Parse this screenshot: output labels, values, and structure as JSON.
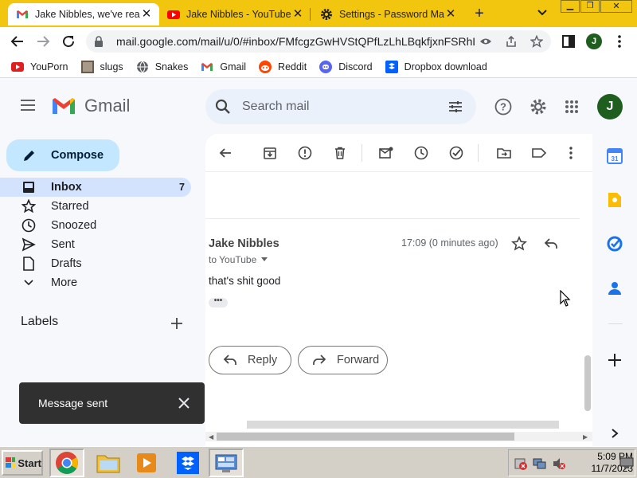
{
  "browser": {
    "tabs": [
      {
        "title": "Jake Nibbles, we've reac",
        "favicon": "gmail-icon",
        "active": true
      },
      {
        "title": "Jake Nibbles - YouTube",
        "favicon": "youtube-icon",
        "active": false
      },
      {
        "title": "Settings - Password Ma",
        "favicon": "gear-icon",
        "active": false
      }
    ],
    "url": "mail.google.com/mail/u/0/#inbox/FMfcgzGwHVStQPfLzLhLBqkfjxnFSRhL",
    "profile_initial": "J",
    "bookmarks": [
      {
        "label": "YouPorn",
        "icon": "youporn-icon"
      },
      {
        "label": "slugs",
        "icon": "image-icon"
      },
      {
        "label": "Snakes",
        "icon": "globe-icon"
      },
      {
        "label": "Gmail",
        "icon": "gmail-icon"
      },
      {
        "label": "Reddit",
        "icon": "reddit-icon"
      },
      {
        "label": "Discord",
        "icon": "discord-icon"
      },
      {
        "label": "Dropbox download",
        "icon": "dropbox-icon"
      }
    ]
  },
  "gmail": {
    "brand": "Gmail",
    "search_placeholder": "Search mail",
    "avatar_initial": "J",
    "compose_label": "Compose",
    "nav": [
      {
        "label": "Inbox",
        "count": "7",
        "icon": "inbox-icon",
        "active": true
      },
      {
        "label": "Starred",
        "count": "",
        "icon": "star-icon",
        "active": false
      },
      {
        "label": "Snoozed",
        "count": "",
        "icon": "clock-icon",
        "active": false
      },
      {
        "label": "Sent",
        "count": "",
        "icon": "send-icon",
        "active": false
      },
      {
        "label": "Drafts",
        "count": "",
        "icon": "draft-icon",
        "active": false
      },
      {
        "label": "More",
        "count": "",
        "icon": "chevron-down-icon",
        "active": false
      }
    ],
    "labels_heading": "Labels",
    "message": {
      "sender": "Jake Nibbles",
      "time": "17:09 (0 minutes ago)",
      "to": "to YouTube",
      "body": "that's shit good",
      "dots": "•••"
    },
    "reply_label": "Reply",
    "forward_label": "Forward",
    "snackbar": "Message sent"
  },
  "taskbar": {
    "start_label": "Start",
    "time": "5:09 PM",
    "date": "11/7/2023"
  },
  "colors": {
    "tab_strip": "#f2c60e",
    "compose_bg": "#c2e7ff",
    "nav_active_bg": "#d3e3fd",
    "avatar_bg": "#1e5e1f"
  }
}
